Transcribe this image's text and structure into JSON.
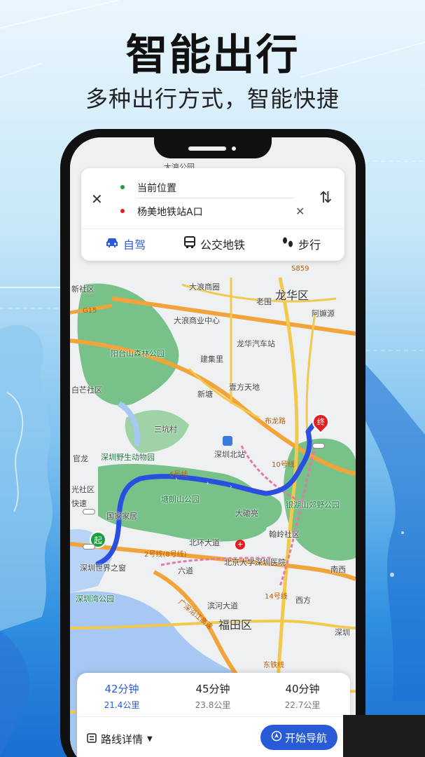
{
  "promo": {
    "headline": "智能出行",
    "subline": "多种出行方式，智能快捷"
  },
  "search": {
    "close_icon": "close-icon",
    "origin": "当前位置",
    "destination": "杨美地铁站A口",
    "clear_icon": "clear-icon",
    "swap_icon": "swap-icon",
    "origin_color": "#1e9e3e",
    "destination_color": "#e02020"
  },
  "modes": [
    {
      "label": "自驾",
      "icon": "car-icon",
      "active": true
    },
    {
      "label": "公交地铁",
      "icon": "bus-icon",
      "active": false
    },
    {
      "label": "步行",
      "icon": "footprint-icon",
      "active": false
    }
  ],
  "map": {
    "labels": {
      "l1": "龙华区",
      "l2": "大浪商圈",
      "l3": "老围",
      "l4": "阿嫲源",
      "l5": "大浪商业中心",
      "l6": "龙华汽车站",
      "l7": "阳台山森林公园",
      "l8": "建集里",
      "l9": "壹方天地",
      "l10": "新塘",
      "l11": "白芒社区",
      "l12": "三坑村",
      "l13": "深圳野生动物园",
      "l14": "深圳北站",
      "l15": "官龙",
      "l16": "塘朗山公园",
      "l17": "大磡亮",
      "l18": "银湖山郊野公园",
      "l19": "翰岭社区",
      "l20": "国家家居",
      "l21": "北环大道",
      "l22": "北京大学深圳医院",
      "l23": "深圳世界之窗",
      "l24": "六道",
      "l25": "深圳湾公园",
      "l26": "滨河大道",
      "l27": "福田区",
      "l28": "西方",
      "l29": "南西",
      "l30": "深圳",
      "l31": "新社区",
      "l32": "光社区",
      "l33": "大浪公园",
      "l34": "快速"
    },
    "roads": {
      "r1": "G15",
      "r2": "S859",
      "r3": "10号线",
      "r4": "6号线",
      "r5": "2号线(8号线)",
      "r6": "14号线",
      "r7": "布龙路",
      "r8": "东铁线",
      "r9": "广深沿江高速"
    },
    "route_color": "#2a4fe0",
    "start_label": "起",
    "end_label": "终",
    "start_color": "#1e9e3e",
    "end_color": "#e02020"
  },
  "routes": [
    {
      "time": "42分钟",
      "distance": "21.4公里",
      "active": true
    },
    {
      "time": "45分钟",
      "distance": "23.8公里",
      "active": false
    },
    {
      "time": "40分钟",
      "distance": "22.7公里",
      "active": false
    }
  ],
  "bottom": {
    "detail_label": "路线详情",
    "detail_icon": "list-icon",
    "nav_label": "开始导航",
    "nav_icon": "navigate-icon",
    "accent": "#2a5bd7"
  }
}
